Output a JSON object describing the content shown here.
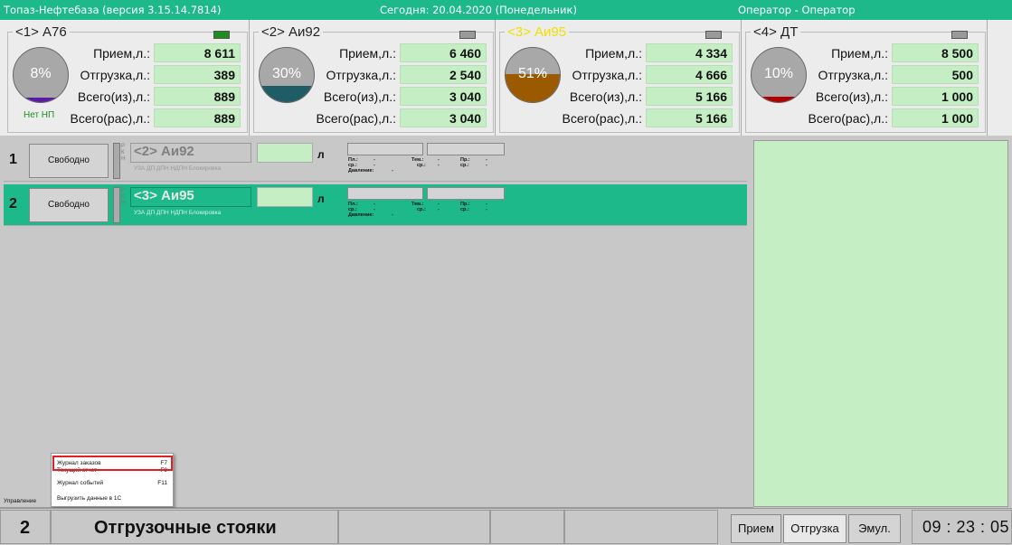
{
  "titlebar": {
    "app": "Топаз-Нефтебаза  (версия 3.15.14.7814)",
    "date": "Сегодня: 20.04.2020  (Понедельник)",
    "operator": "Оператор - Оператор"
  },
  "tank_labels": {
    "receipt": "Прием,л.:",
    "shipment": "Отгрузка,л.:",
    "total_out": "Всего(из),л.:",
    "total_calc": "Всего(рас),л.:"
  },
  "tanks": [
    {
      "name": "<1> А76",
      "percent": "8%",
      "level": 0.08,
      "fill_color": "#5b1ba6",
      "indicator_color": "#1e8c1e",
      "receipt": "8 611",
      "shipment": "389",
      "total_out": "889",
      "total_calc": "889",
      "note": "Нет НП",
      "name_color": "#222222"
    },
    {
      "name": "<2> Аи92",
      "percent": "30%",
      "level": 0.3,
      "fill_color": "#1f5c66",
      "indicator_color": "#9a9a9a",
      "receipt": "6 460",
      "shipment": "2 540",
      "total_out": "3 040",
      "total_calc": "3 040",
      "note": "",
      "name_color": "#222222"
    },
    {
      "name": "<3> Аи95",
      "percent": "51%",
      "level": 0.51,
      "fill_color": "#9c5a00",
      "indicator_color": "#9a9a9a",
      "receipt": "4 334",
      "shipment": "4 666",
      "total_out": "5 166",
      "total_calc": "5 166",
      "note": "",
      "name_color": "#f0e000"
    },
    {
      "name": "<4> ДТ",
      "percent": "10%",
      "level": 0.1,
      "fill_color": "#b00000",
      "indicator_color": "#9a9a9a",
      "receipt": "8 500",
      "shipment": "500",
      "total_out": "1 000",
      "total_calc": "1 000",
      "note": "",
      "name_color": "#222222"
    }
  ],
  "posts": [
    {
      "num": "1",
      "state": "Свободно",
      "fuel": "<2> Аи92",
      "flags": "УЗА  ДП  ДПН  НДПН  Блокировка",
      "rkn": "Р К Н",
      "unit": "л",
      "active": false
    },
    {
      "num": "2",
      "state": "Свободно",
      "fuel": "<3> Аи95",
      "flags": "УЗА  ДП  ДПН  НДПН  Блокировка",
      "rkn": "Р К Н",
      "unit": "л",
      "active": true
    }
  ],
  "post_params": {
    "pl": "Пл.:",
    "sr": "ср.:",
    "tem": "Тем.:",
    "sr2": "ср.:",
    "pr": "Пр.:",
    "sr3": "ср.:",
    "pressure": "Давление:",
    "dash": "-"
  },
  "menu": {
    "items": [
      {
        "label": "Журнал заказов",
        "key": "F7"
      },
      {
        "label": "Текущий отчет",
        "key": "F9"
      },
      {
        "label": "Журнал событий",
        "key": "F11"
      },
      {
        "label": "Выгрузить данные в 1С",
        "key": ""
      }
    ]
  },
  "control_label": "Управление",
  "bottom": {
    "num": "2",
    "title": "Отгрузочные стояки",
    "btn_receipt": "Прием",
    "btn_shipment": "Отгрузка",
    "btn_emul": "Эмул.",
    "clock": "09 : 23 : 05"
  }
}
